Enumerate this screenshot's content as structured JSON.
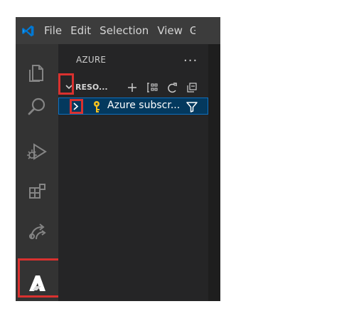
{
  "window": {
    "menu": [
      "File",
      "Edit",
      "Selection",
      "View",
      "G"
    ]
  },
  "activity_bar": {
    "items": [
      {
        "name": "explorer",
        "icon": "files-icon"
      },
      {
        "name": "search",
        "icon": "search-icon"
      },
      {
        "name": "run-debug",
        "icon": "debug-icon"
      },
      {
        "name": "extensions",
        "icon": "extensions-icon"
      },
      {
        "name": "remote",
        "icon": "remote-icon"
      },
      {
        "name": "azure",
        "icon": "azure-icon",
        "highlighted": true
      }
    ]
  },
  "sidebar": {
    "title": "AZURE",
    "more_actions": "...",
    "section": {
      "title": "RESO...",
      "expanded": true,
      "actions": [
        "plus-icon",
        "group-by-icon",
        "refresh-icon",
        "collapse-all-icon"
      ]
    },
    "tree": {
      "items": [
        {
          "label": "Azure subscr...",
          "icon": "key-icon",
          "expanded": false,
          "selected": true,
          "highlighted_chevron": true
        }
      ]
    }
  },
  "colors": {
    "titlebar": "#3c3c3c",
    "activity_bar": "#333333",
    "sidebar": "#252526",
    "selection": "#04395e",
    "selection_border": "#0e70c0",
    "highlight": "#d9312f",
    "key": "#f4c11f"
  }
}
